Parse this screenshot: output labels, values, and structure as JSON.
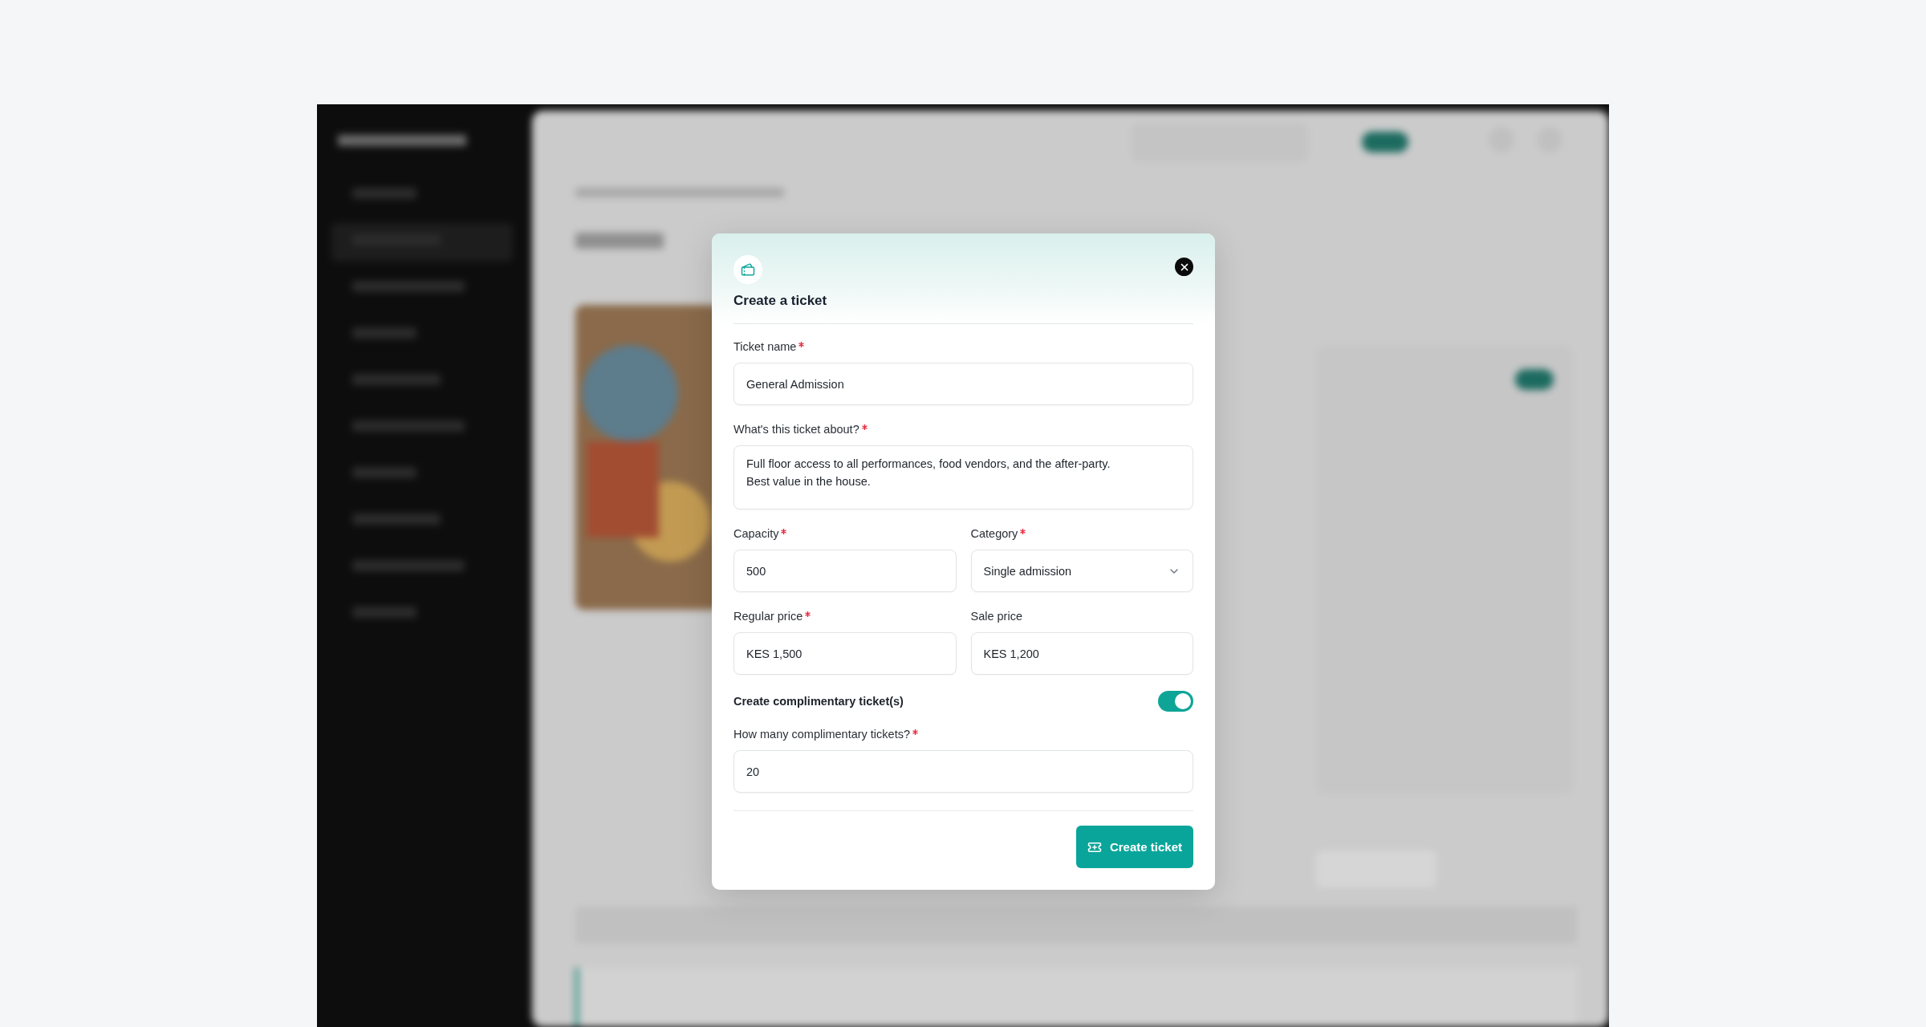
{
  "modal": {
    "title": "Create a ticket",
    "sections": [
      {
        "kind": "row",
        "fields": [
          {
            "kind": "text",
            "label": "Ticket name",
            "required": true,
            "value": "General Admission"
          }
        ]
      },
      {
        "kind": "row",
        "fields": [
          {
            "kind": "textarea",
            "label": "What's this ticket about?",
            "required": true,
            "value": "Full floor access to all performances, food vendors, and the after-party.\nBest value in the house."
          }
        ]
      },
      {
        "kind": "row",
        "fields": [
          {
            "kind": "text",
            "label": "Capacity",
            "required": true,
            "value": "500"
          },
          {
            "kind": "select",
            "label": "Category",
            "required": true,
            "value": "Single admission"
          }
        ]
      },
      {
        "kind": "row",
        "fields": [
          {
            "kind": "text",
            "label": "Regular price",
            "required": true,
            "value": "KES 1,500"
          },
          {
            "kind": "text",
            "label": "Sale price",
            "required": false,
            "value": "KES 1,200"
          }
        ]
      },
      {
        "kind": "toggle",
        "label": "Create complimentary ticket(s)",
        "on": true
      },
      {
        "kind": "row",
        "fields": [
          {
            "kind": "text",
            "label": "How many complimentary tickets?",
            "required": true,
            "value": "20"
          }
        ]
      }
    ],
    "submit": "Create ticket"
  }
}
